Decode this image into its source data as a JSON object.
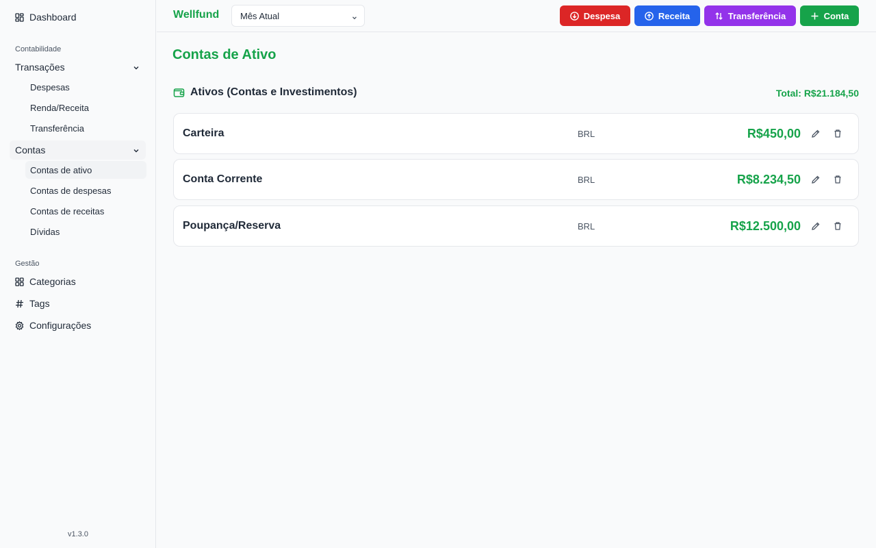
{
  "sidebar": {
    "dashboard": "Dashboard",
    "section_accounting": "Contabilidade",
    "transactions": "Transações",
    "transactions_children": [
      "Despesas",
      "Renda/Receita",
      "Transferência"
    ],
    "accounts": "Contas",
    "accounts_children": [
      "Contas de ativo",
      "Contas de despesas",
      "Contas de receitas",
      "Dívidas"
    ],
    "section_management": "Gestão",
    "categories": "Categorias",
    "tags": "Tags",
    "settings": "Configurações",
    "version": "v1.3.0"
  },
  "header": {
    "brand": "Wellfund",
    "period": "Mês Atual",
    "buttons": {
      "expense": "Despesa",
      "income": "Receita",
      "transfer": "Transferência",
      "account": "Conta"
    }
  },
  "main": {
    "title": "Contas de Ativo",
    "section_title": "Ativos (Contas e Investimentos)",
    "total": "Total: R$21.184,50",
    "accounts": [
      {
        "name": "Carteira",
        "currency": "BRL",
        "amount": "R$450,00"
      },
      {
        "name": "Conta Corrente",
        "currency": "BRL",
        "amount": "R$8.234,50"
      },
      {
        "name": "Poupança/Reserva",
        "currency": "BRL",
        "amount": "R$12.500,00"
      }
    ]
  },
  "colors": {
    "brand_green": "#16a34a",
    "expense_red": "#dc2626",
    "income_blue": "#2563eb",
    "transfer_purple": "#9333ea"
  },
  "icons": [
    "dashboard-icon",
    "chevron-down-icon",
    "grid-icon",
    "hash-icon",
    "gear-icon",
    "arrow-down-circle-icon",
    "arrow-up-circle-icon",
    "swap-icon",
    "plus-icon",
    "wallet-icon",
    "pencil-icon",
    "trash-icon"
  ]
}
